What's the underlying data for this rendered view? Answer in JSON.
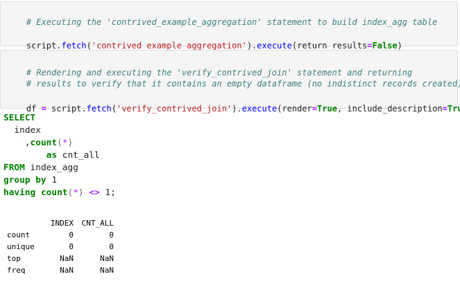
{
  "cell1": {
    "comment": "# Executing the 'contrived_example_aggregation' statement to build index_agg table",
    "line2": {
      "prefix": "script.",
      "fetch": "fetch",
      "open": "(",
      "arg": "'contrived_example_aggregation'",
      "close": ")",
      "dot": ".",
      "execute": "execute",
      "param_open": "(",
      "param": "return_results",
      "eq": "=",
      "value": "False",
      "param_close": ")"
    }
  },
  "cell2": {
    "comment1": "# Rendering and executing the 'verify_contrived_join' statement and returning",
    "comment2": "# results to verify that it contains an empty dataframe (no indistinct records created)",
    "line": {
      "var": "df",
      "assign": " = ",
      "prefix": "script.",
      "fetch": "fetch",
      "open": "(",
      "arg": "'verify_contrived_join'",
      "close": ")",
      "dot": ".",
      "execute": "execute",
      "param_open": "(",
      "param1": "render",
      "eq1": "=",
      "val1": "True",
      "comma": ", ",
      "param2": "include_description",
      "eq2": "=",
      "val2": "True",
      "param_close": ")"
    }
  },
  "sql": {
    "select": "SELECT",
    "index": "  index",
    "count_prefix": "    ,",
    "count": "count",
    "paren_open": "(",
    "star": "*",
    "paren_close": ")",
    "as_indent": "        ",
    "as": "as",
    "as_alias": " cnt_all",
    "from": "FROM",
    "from_table": " index_agg",
    "group_by": "group by",
    "group_val": " 1",
    "having": "having",
    "having_space": " ",
    "having_count": "count",
    "having_paren_open": "(",
    "having_star": "*",
    "having_paren_close": ")",
    "having_space2": " ",
    "neq": "<>",
    "tail": " 1;"
  },
  "dataframe": {
    "columns": [
      "",
      "INDEX",
      "CNT_ALL"
    ],
    "rows": [
      {
        "label": "count",
        "index": "0",
        "cnt_all": "0"
      },
      {
        "label": "unique",
        "index": "0",
        "cnt_all": "0"
      },
      {
        "label": "top",
        "index": "NaN",
        "cnt_all": "NaN"
      },
      {
        "label": "freq",
        "index": "NaN",
        "cnt_all": "NaN"
      }
    ]
  }
}
